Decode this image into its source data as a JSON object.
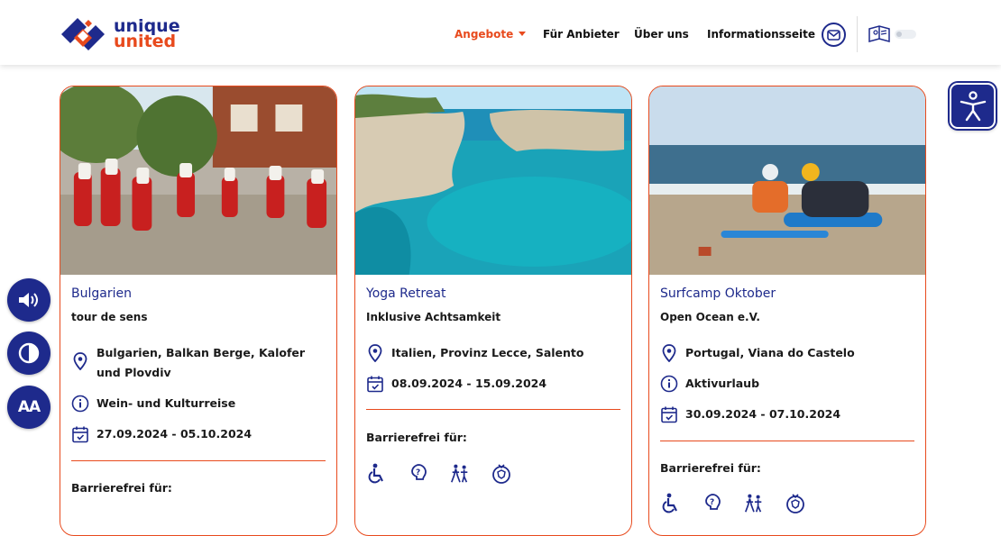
{
  "header": {
    "logo": {
      "line1": "unique",
      "line2": "united"
    },
    "nav": [
      {
        "label": "Angebote"
      },
      {
        "label": "Für Anbieter"
      },
      {
        "label": "Über uns"
      },
      {
        "label": "Informationsseite"
      }
    ]
  },
  "cards": [
    {
      "title": "Bulgarien",
      "provider": "tour de sens",
      "location": "Bulgarien, Balkan Berge, Kalofer und Plovdiv",
      "category": "Wein- und Kulturreise",
      "dates": "27.09.2024 - 05.10.2024",
      "accessible_label": "Barrierefrei für:"
    },
    {
      "title": "Yoga Retreat",
      "provider": "Inklusive Achtsamkeit",
      "location": "Italien, Provinz Lecce, Salento",
      "dates": "08.09.2024 - 15.09.2024",
      "accessible_label": "Barrierefrei für:"
    },
    {
      "title": "Surfcamp Oktober",
      "provider": "Open Ocean e.V.",
      "location": "Portugal, Viana do Castelo",
      "category": "Aktivurlaub",
      "dates": "30.09.2024 - 07.10.2024",
      "accessible_label": "Barrierefrei für:"
    }
  ],
  "side_tools": {
    "font_size_label": "AA"
  },
  "colors": {
    "brand_blue": "#1e2a8c",
    "accent_orange": "#e84a1d"
  }
}
